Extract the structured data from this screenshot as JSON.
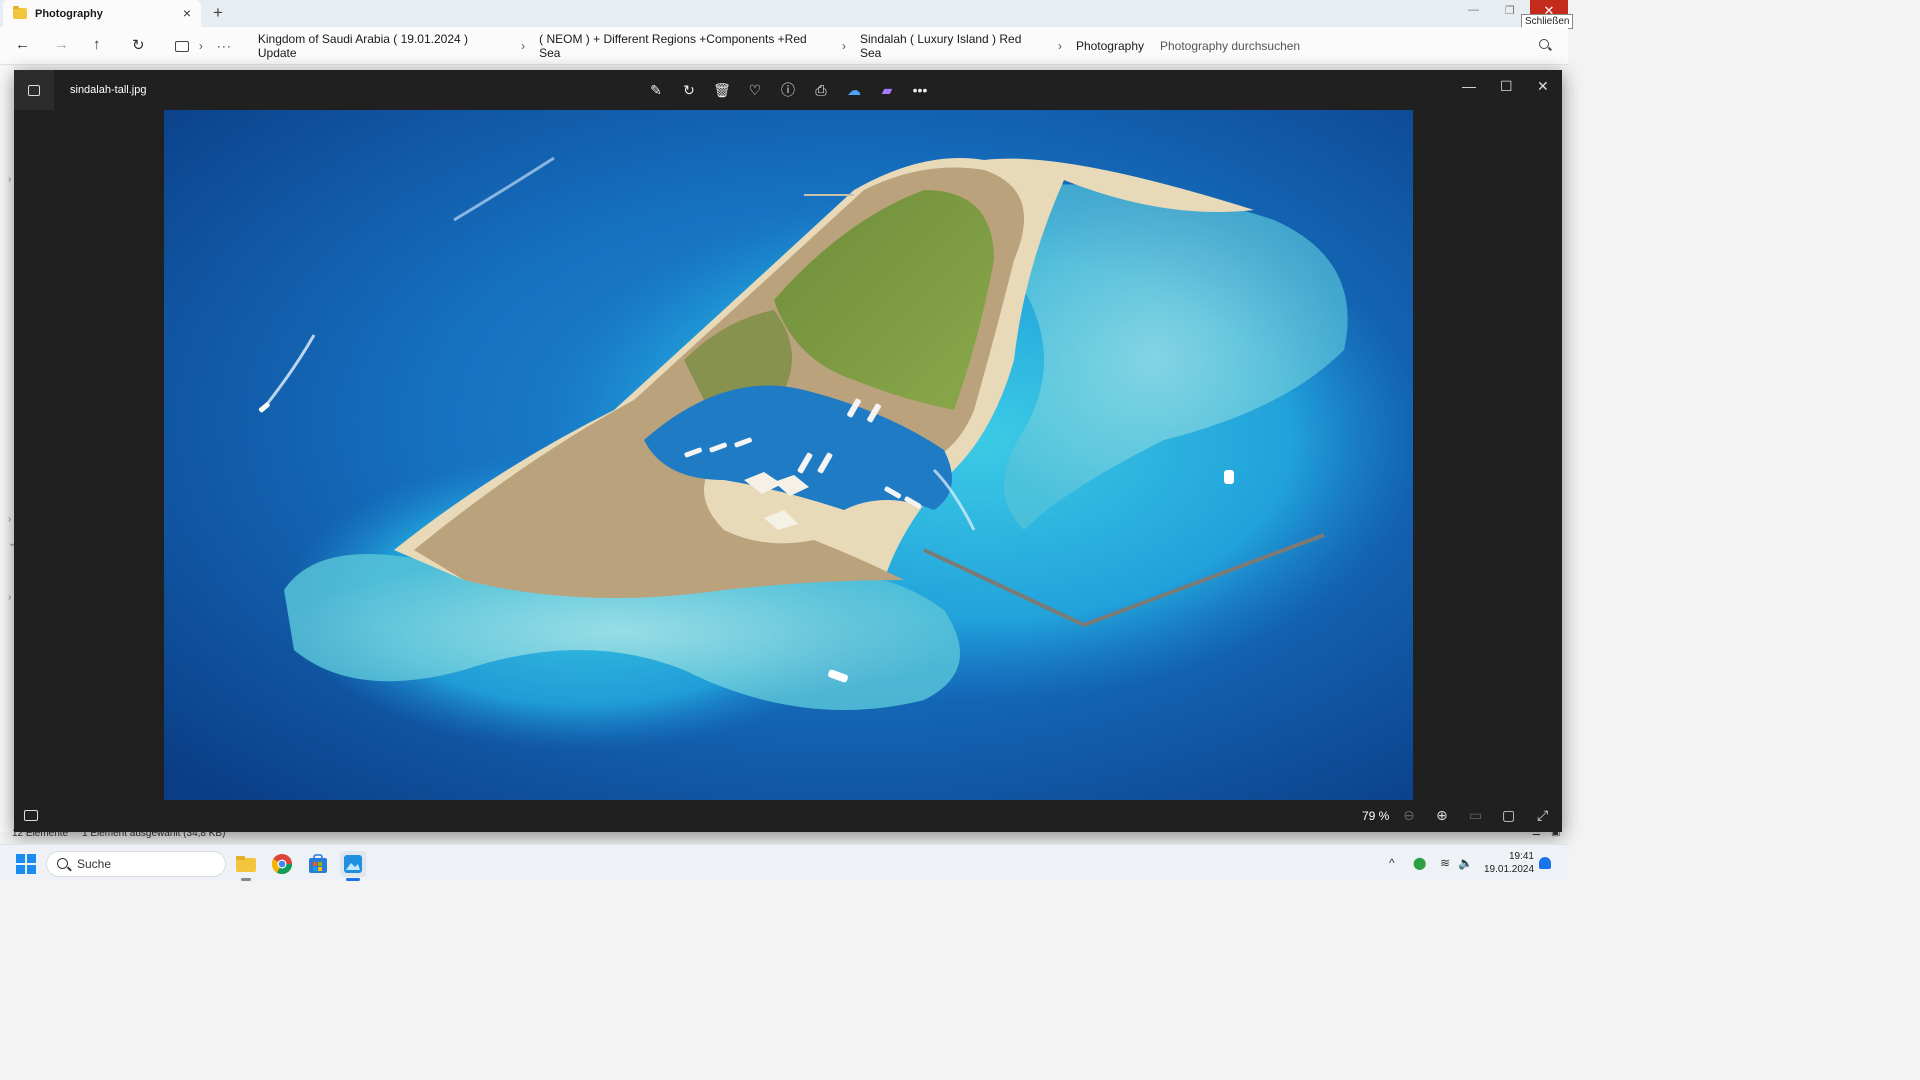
{
  "explorer": {
    "tab_title": "Photography",
    "close_tooltip": "Schließen",
    "breadcrumb": [
      "Kingdom of Saudi Arabia ( 19.01.2024 ) Update",
      "( NEOM ) + Different Regions +Components +Red Sea",
      "Sindalah ( Luxury Island ) Red Sea",
      "Photography"
    ],
    "search_placeholder": "Photography durchsuchen",
    "status_count": "12 Elemente",
    "status_selected": "1 Element ausgewählt (34,8 KB)"
  },
  "viewer": {
    "filename": "sindalah-tall.jpg",
    "zoom": "79 %",
    "image_description_icon": "aerial-island-photo"
  },
  "taskbar": {
    "search_label": "Suche",
    "time": "19:41",
    "date": "19.01.2024"
  },
  "colors": {
    "close_red": "#c42b1c",
    "viewer_bg": "#202020",
    "accent": "#1a73e8"
  }
}
